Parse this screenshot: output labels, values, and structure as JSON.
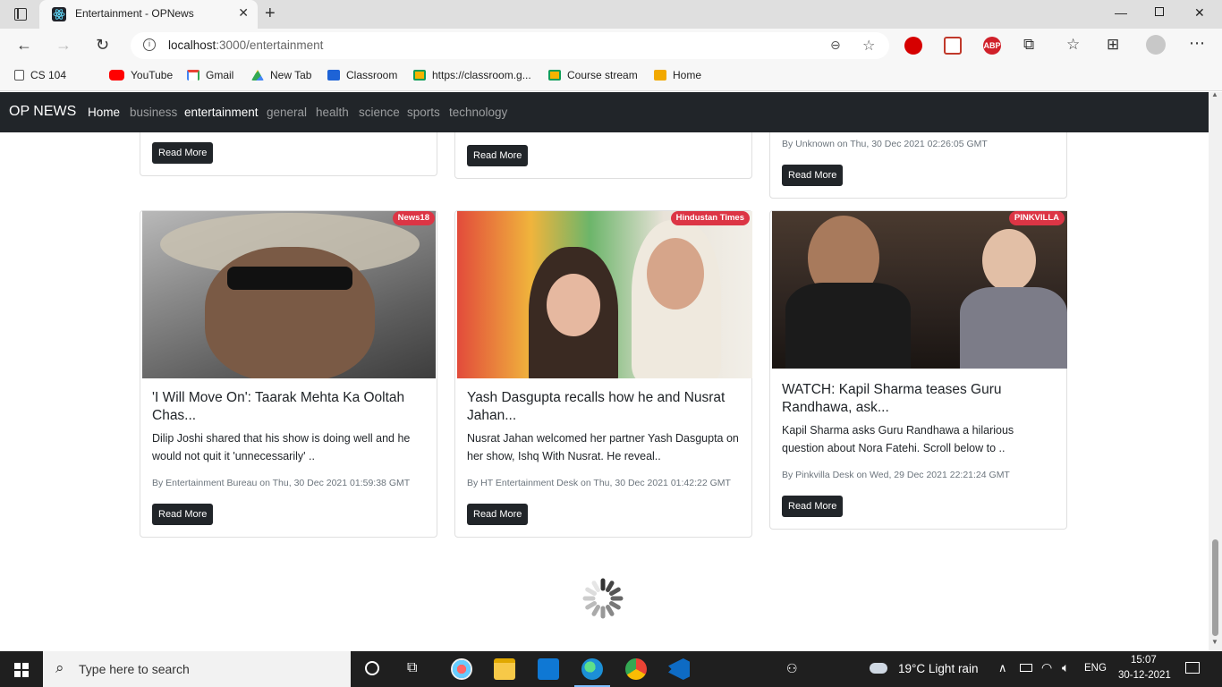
{
  "browser": {
    "tab_title": "Entertainment - OPNews",
    "url_host": "localhost",
    "url_path": ":3000/entertainment",
    "bookmarks": [
      "CS 104",
      "YouTube",
      "Gmail",
      "New Tab",
      "Classroom",
      "https://classroom.g...",
      "Course stream",
      "Home"
    ],
    "ext_labels": [
      "",
      "",
      "ABP"
    ]
  },
  "nav": {
    "brand": "OP NEWS",
    "links": [
      "Home",
      "business",
      "entertainment",
      "general",
      "health",
      "science",
      "sports",
      "technology"
    ],
    "active": [
      "Home",
      "entertainment"
    ]
  },
  "top_cards": [
    {
      "button": "Read More"
    },
    {
      "button": "Read More"
    },
    {
      "byline": "By Unknown on Thu, 30 Dec 2021 02:26:05 GMT",
      "button": "Read More"
    }
  ],
  "cards": [
    {
      "source": "News18",
      "title": "'I Will Move On': Taarak Mehta Ka Ooltah Chas...",
      "description": "Dilip Joshi shared that his show is doing well and he would not quit it 'unnecessarily' ..",
      "byline": "By Entertainment Bureau on Thu, 30 Dec 2021 01:59:38 GMT",
      "button": "Read More"
    },
    {
      "source": "Hindustan Times",
      "title": "Yash Dasgupta recalls how he and Nusrat Jahan...",
      "description": "Nusrat Jahan welcomed her partner Yash Dasgupta on her show, Ishq With Nusrat. He reveal..",
      "byline": "By HT Entertainment Desk on Thu, 30 Dec 2021 01:42:22 GMT",
      "button": "Read More"
    },
    {
      "source": "PINKVILLA",
      "title": "WATCH: Kapil Sharma teases Guru Randhawa, ask...",
      "description": "Kapil Sharma asks Guru Randhawa a hilarious question about Nora Fatehi. Scroll below to ..",
      "byline": "By Pinkvilla Desk on Wed, 29 Dec 2021 22:21:24 GMT",
      "button": "Read More"
    }
  ],
  "taskbar": {
    "search_placeholder": "Type here to search",
    "weather": "19°C  Light rain",
    "lang": "ENG",
    "time": "15:07",
    "date": "30-12-2021"
  },
  "colors": {
    "navbar": "#212529",
    "badge": "#dc3545",
    "button": "#212529"
  }
}
